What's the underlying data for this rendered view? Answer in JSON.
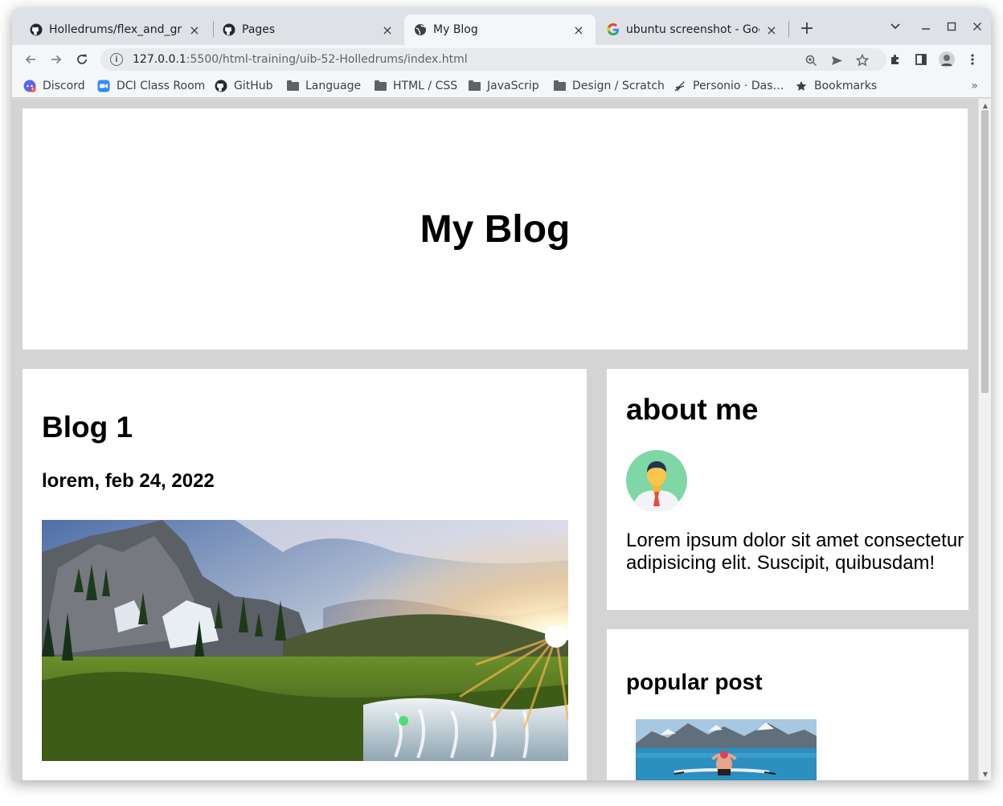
{
  "browser": {
    "tabs": [
      {
        "title": "Holledrums/flex_and_grid",
        "favicon": "github-icon",
        "active": false
      },
      {
        "title": "Pages",
        "favicon": "github-icon",
        "active": false
      },
      {
        "title": "My Blog",
        "favicon": "globe-icon",
        "active": true
      },
      {
        "title": "ubuntu screenshot - Google",
        "favicon": "google-icon",
        "active": false
      }
    ],
    "url_host": "127.0.0.1",
    "url_rest": ":5500/html-training/uib-52-Holledrums/index.html",
    "bookmarks": [
      {
        "label": "Discord",
        "icon": "discord-icon"
      },
      {
        "label": "DCI Class Room",
        "icon": "zoom-icon"
      },
      {
        "label": "GitHub",
        "icon": "github-icon"
      },
      {
        "label": "Language",
        "icon": "folder-icon"
      },
      {
        "label": "HTML / CSS",
        "icon": "folder-icon"
      },
      {
        "label": "JavaScrip",
        "icon": "folder-icon"
      },
      {
        "label": "Design / Scratch",
        "icon": "folder-icon"
      },
      {
        "label": "Personio · Das…",
        "icon": "personio-icon"
      },
      {
        "label": "Bookmarks",
        "icon": "star-icon"
      }
    ],
    "bookmarks_overflow": "»"
  },
  "page": {
    "site_title": "My Blog",
    "post": {
      "title": "Blog 1",
      "meta": "lorem, feb 24, 2022"
    },
    "about": {
      "heading": "about me",
      "text": "Lorem ipsum dolor sit amet consectetur adipisicing elit. Suscipit, quibusdam!"
    },
    "popular": {
      "heading": "popular post"
    }
  },
  "colors": {
    "tabstrip": "#dee1e6",
    "toolbar": "#f5f6f7",
    "page_bg": "#d4d4d4",
    "card_bg": "#ffffff"
  }
}
